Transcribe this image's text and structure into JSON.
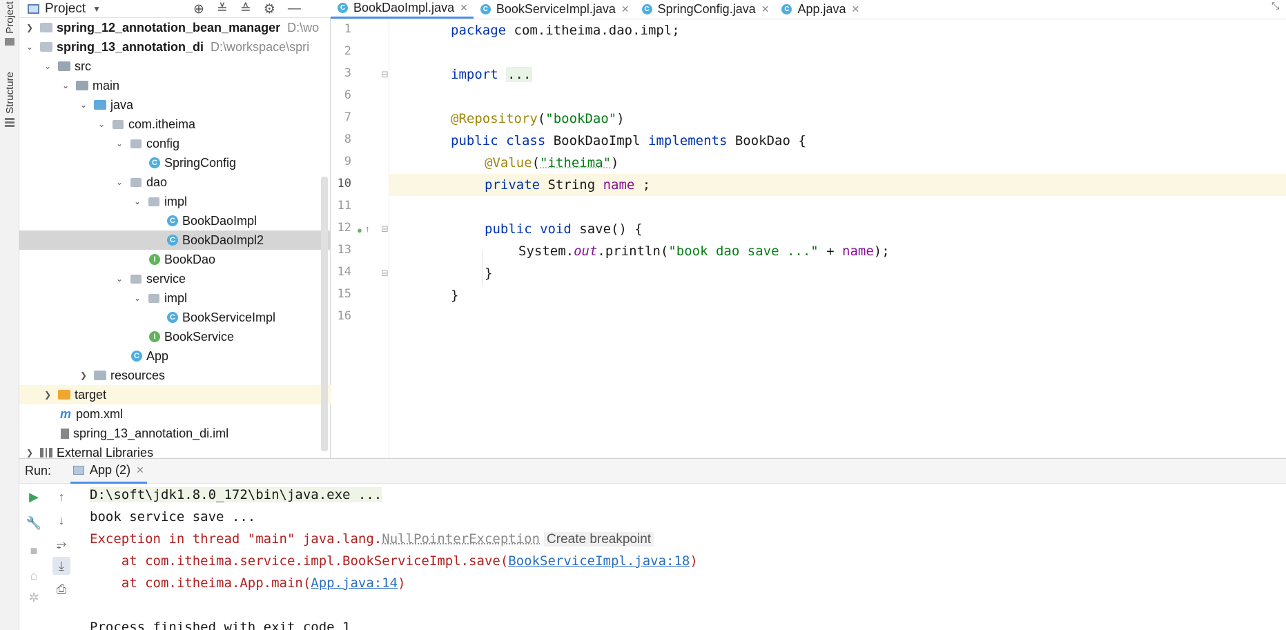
{
  "left_strip": {
    "project_label": "Project",
    "structure_label": "Structure"
  },
  "project_panel": {
    "title": "Project",
    "tree": [
      {
        "label": "spring_12_annotation_bean_manager",
        "path": "D:\\wo",
        "bold": true
      },
      {
        "label": "spring_13_annotation_di",
        "path": "D:\\workspace\\spri",
        "bold": true
      },
      {
        "label": "src"
      },
      {
        "label": "main"
      },
      {
        "label": "java"
      },
      {
        "label": "com.itheima"
      },
      {
        "label": "config"
      },
      {
        "label": "SpringConfig"
      },
      {
        "label": "dao"
      },
      {
        "label": "impl"
      },
      {
        "label": "BookDaoImpl"
      },
      {
        "label": "BookDaoImpl2"
      },
      {
        "label": "BookDao"
      },
      {
        "label": "service"
      },
      {
        "label": "impl"
      },
      {
        "label": "BookServiceImpl"
      },
      {
        "label": "BookService"
      },
      {
        "label": "App"
      },
      {
        "label": "resources"
      },
      {
        "label": "target"
      },
      {
        "label": "pom.xml"
      },
      {
        "label": "spring_13_annotation_di.iml"
      },
      {
        "label": "External Libraries"
      }
    ]
  },
  "editor": {
    "tabs": [
      {
        "label": "BookDaoImpl.java",
        "active": true
      },
      {
        "label": "BookServiceImpl.java"
      },
      {
        "label": "SpringConfig.java"
      },
      {
        "label": "App.java"
      }
    ],
    "line_numbers": [
      "1",
      "2",
      "3",
      "6",
      "7",
      "8",
      "9",
      "10",
      "11",
      "12",
      "13",
      "14",
      "15",
      "16"
    ],
    "code": {
      "l1_kw": "package",
      "l1_rest": " com.itheima.dao.impl;",
      "l3_kw": "import",
      "l3_fold": "...",
      "l7_ann": "@Repository",
      "l7_open": "(",
      "l7_str": "\"bookDao\"",
      "l7_close": ")",
      "l8_kw1": "public class",
      "l8_name": " BookDaoImpl ",
      "l8_kw2": "implements",
      "l8_rest": " BookDao {",
      "l9_ann": "@Value",
      "l9_open": "(",
      "l9_str": "\"itheima\"",
      "l9_close": ")",
      "l10_kw": "private",
      "l10_type": " String ",
      "l10_field": "name",
      "l10_end": " ;",
      "l12_kw": "public void",
      "l12_rest": " save() {",
      "l13_a": "System.",
      "l13_out": "out",
      "l13_b": ".println(",
      "l13_str": "\"book dao save ...\"",
      "l13_c": " + ",
      "l13_field": "name",
      "l13_d": ");",
      "l14": "}",
      "l15": "}"
    }
  },
  "run_panel": {
    "label": "Run:",
    "tab": "App (2)",
    "console": {
      "cmd": "D:\\soft\\jdk1.8.0_172\\bin\\java.exe ...",
      "out1": "book service save ...",
      "exc_prefix": "Exception in thread \"main\" java.lang.",
      "exc_name": "NullPointerException",
      "create_bp": "Create breakpoint",
      "trace1_prefix": "    at com.itheima.service.impl.BookServiceImpl.save(",
      "trace1_link": "BookServiceImpl.java:18",
      "trace1_suffix": ")",
      "trace2_prefix": "    at com.itheima.App.main(",
      "trace2_link": "App.java:14",
      "trace2_suffix": ")",
      "finish": "Process finished with exit code 1"
    }
  },
  "colors": {
    "keyword": "#0033b3",
    "annotation": "#9e880d",
    "string": "#067d17",
    "field": "#871094",
    "error": "#b32020",
    "link": "#2a6fc0",
    "selection": "#d5d5d5",
    "active_tab": "#4b8ef1"
  },
  "icons": [
    "project-icon",
    "locate-icon",
    "expand-all-icon",
    "collapse-all-icon",
    "gear-icon",
    "minimize-icon",
    "run-icon",
    "wrench-icon",
    "stop-icon",
    "camera-icon",
    "settings-icon",
    "up-arrow-icon",
    "down-arrow-icon",
    "soft-wrap-icon",
    "scroll-to-end-icon",
    "print-icon"
  ]
}
